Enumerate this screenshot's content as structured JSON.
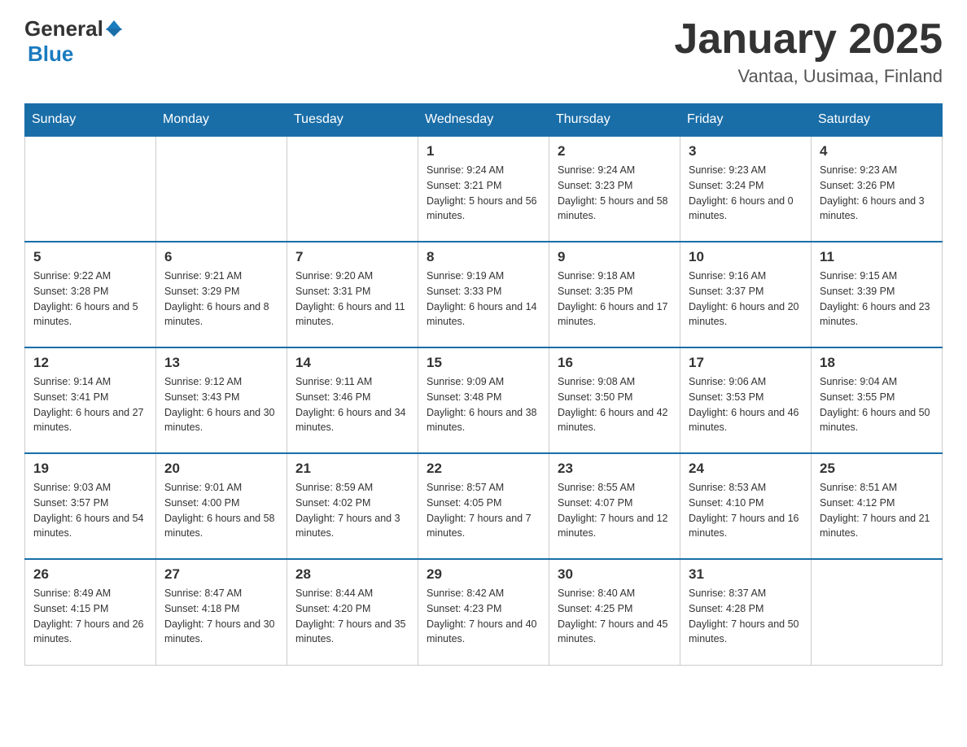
{
  "header": {
    "logo_general": "General",
    "logo_blue": "Blue",
    "title": "January 2025",
    "subtitle": "Vantaa, Uusimaa, Finland"
  },
  "days_of_week": [
    "Sunday",
    "Monday",
    "Tuesday",
    "Wednesday",
    "Thursday",
    "Friday",
    "Saturday"
  ],
  "weeks": [
    [
      {
        "day": "",
        "info": ""
      },
      {
        "day": "",
        "info": ""
      },
      {
        "day": "",
        "info": ""
      },
      {
        "day": "1",
        "info": "Sunrise: 9:24 AM\nSunset: 3:21 PM\nDaylight: 5 hours\nand 56 minutes."
      },
      {
        "day": "2",
        "info": "Sunrise: 9:24 AM\nSunset: 3:23 PM\nDaylight: 5 hours\nand 58 minutes."
      },
      {
        "day": "3",
        "info": "Sunrise: 9:23 AM\nSunset: 3:24 PM\nDaylight: 6 hours\nand 0 minutes."
      },
      {
        "day": "4",
        "info": "Sunrise: 9:23 AM\nSunset: 3:26 PM\nDaylight: 6 hours\nand 3 minutes."
      }
    ],
    [
      {
        "day": "5",
        "info": "Sunrise: 9:22 AM\nSunset: 3:28 PM\nDaylight: 6 hours\nand 5 minutes."
      },
      {
        "day": "6",
        "info": "Sunrise: 9:21 AM\nSunset: 3:29 PM\nDaylight: 6 hours\nand 8 minutes."
      },
      {
        "day": "7",
        "info": "Sunrise: 9:20 AM\nSunset: 3:31 PM\nDaylight: 6 hours\nand 11 minutes."
      },
      {
        "day": "8",
        "info": "Sunrise: 9:19 AM\nSunset: 3:33 PM\nDaylight: 6 hours\nand 14 minutes."
      },
      {
        "day": "9",
        "info": "Sunrise: 9:18 AM\nSunset: 3:35 PM\nDaylight: 6 hours\nand 17 minutes."
      },
      {
        "day": "10",
        "info": "Sunrise: 9:16 AM\nSunset: 3:37 PM\nDaylight: 6 hours\nand 20 minutes."
      },
      {
        "day": "11",
        "info": "Sunrise: 9:15 AM\nSunset: 3:39 PM\nDaylight: 6 hours\nand 23 minutes."
      }
    ],
    [
      {
        "day": "12",
        "info": "Sunrise: 9:14 AM\nSunset: 3:41 PM\nDaylight: 6 hours\nand 27 minutes."
      },
      {
        "day": "13",
        "info": "Sunrise: 9:12 AM\nSunset: 3:43 PM\nDaylight: 6 hours\nand 30 minutes."
      },
      {
        "day": "14",
        "info": "Sunrise: 9:11 AM\nSunset: 3:46 PM\nDaylight: 6 hours\nand 34 minutes."
      },
      {
        "day": "15",
        "info": "Sunrise: 9:09 AM\nSunset: 3:48 PM\nDaylight: 6 hours\nand 38 minutes."
      },
      {
        "day": "16",
        "info": "Sunrise: 9:08 AM\nSunset: 3:50 PM\nDaylight: 6 hours\nand 42 minutes."
      },
      {
        "day": "17",
        "info": "Sunrise: 9:06 AM\nSunset: 3:53 PM\nDaylight: 6 hours\nand 46 minutes."
      },
      {
        "day": "18",
        "info": "Sunrise: 9:04 AM\nSunset: 3:55 PM\nDaylight: 6 hours\nand 50 minutes."
      }
    ],
    [
      {
        "day": "19",
        "info": "Sunrise: 9:03 AM\nSunset: 3:57 PM\nDaylight: 6 hours\nand 54 minutes."
      },
      {
        "day": "20",
        "info": "Sunrise: 9:01 AM\nSunset: 4:00 PM\nDaylight: 6 hours\nand 58 minutes."
      },
      {
        "day": "21",
        "info": "Sunrise: 8:59 AM\nSunset: 4:02 PM\nDaylight: 7 hours\nand 3 minutes."
      },
      {
        "day": "22",
        "info": "Sunrise: 8:57 AM\nSunset: 4:05 PM\nDaylight: 7 hours\nand 7 minutes."
      },
      {
        "day": "23",
        "info": "Sunrise: 8:55 AM\nSunset: 4:07 PM\nDaylight: 7 hours\nand 12 minutes."
      },
      {
        "day": "24",
        "info": "Sunrise: 8:53 AM\nSunset: 4:10 PM\nDaylight: 7 hours\nand 16 minutes."
      },
      {
        "day": "25",
        "info": "Sunrise: 8:51 AM\nSunset: 4:12 PM\nDaylight: 7 hours\nand 21 minutes."
      }
    ],
    [
      {
        "day": "26",
        "info": "Sunrise: 8:49 AM\nSunset: 4:15 PM\nDaylight: 7 hours\nand 26 minutes."
      },
      {
        "day": "27",
        "info": "Sunrise: 8:47 AM\nSunset: 4:18 PM\nDaylight: 7 hours\nand 30 minutes."
      },
      {
        "day": "28",
        "info": "Sunrise: 8:44 AM\nSunset: 4:20 PM\nDaylight: 7 hours\nand 35 minutes."
      },
      {
        "day": "29",
        "info": "Sunrise: 8:42 AM\nSunset: 4:23 PM\nDaylight: 7 hours\nand 40 minutes."
      },
      {
        "day": "30",
        "info": "Sunrise: 8:40 AM\nSunset: 4:25 PM\nDaylight: 7 hours\nand 45 minutes."
      },
      {
        "day": "31",
        "info": "Sunrise: 8:37 AM\nSunset: 4:28 PM\nDaylight: 7 hours\nand 50 minutes."
      },
      {
        "day": "",
        "info": ""
      }
    ]
  ]
}
